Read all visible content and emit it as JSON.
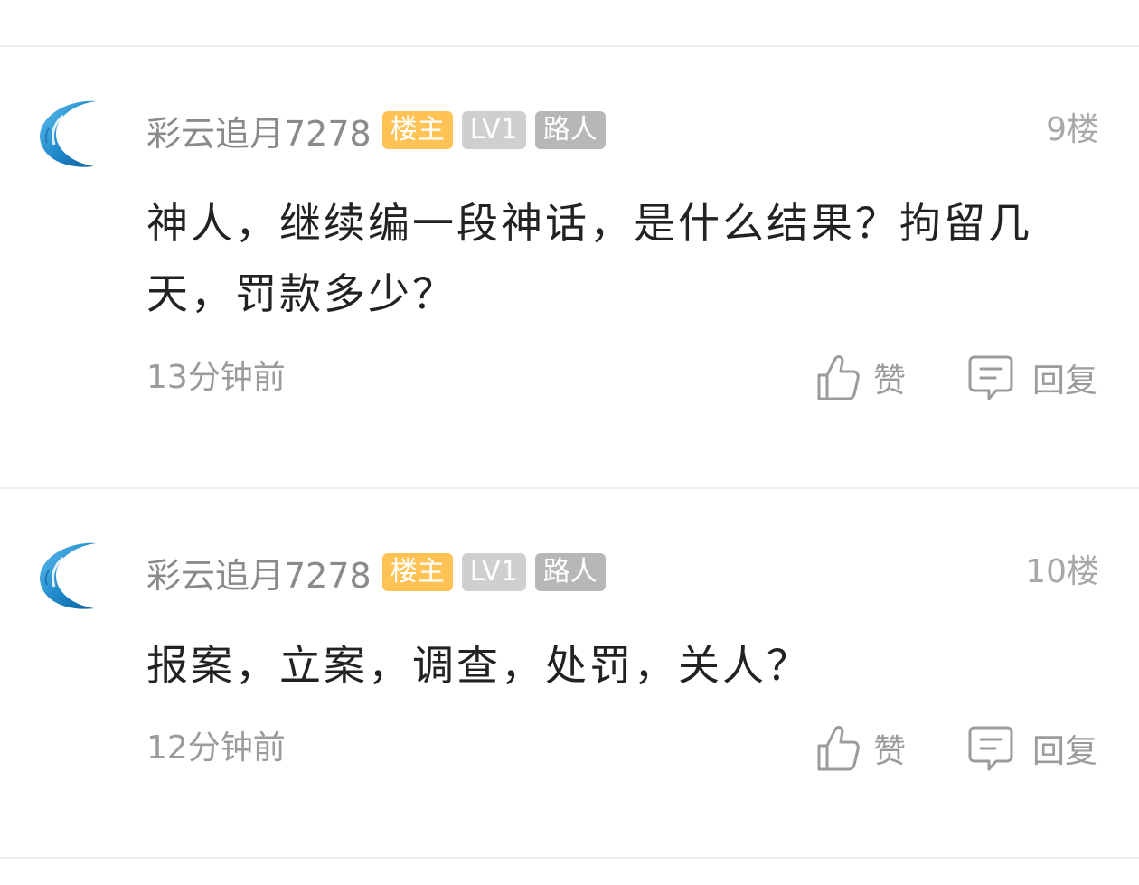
{
  "comments": [
    {
      "username": "彩云追月7278",
      "badge_op": "楼主",
      "badge_level": "LV1",
      "badge_role": "路人",
      "floor": "9楼",
      "content": "神人，继续编一段神话，是什么结果？拘留几天，罚款多少？",
      "time": "13分钟前",
      "like_label": "赞",
      "reply_label": "回复"
    },
    {
      "username": "彩云追月7278",
      "badge_op": "楼主",
      "badge_level": "LV1",
      "badge_role": "路人",
      "floor": "10楼",
      "content": "报案，立案，调查，处罚，关人？",
      "time": "12分钟前",
      "like_label": "赞",
      "reply_label": "回复"
    }
  ],
  "icons": {
    "avatar": "crescent-moon-icon",
    "like": "thumbs-up-icon",
    "reply": "speech-bubble-icon"
  },
  "colors": {
    "badge_op": "#ffc254",
    "badge_level": "#cfcfcf",
    "badge_role": "#b7b7b7",
    "avatar_blue": "#1f88c9"
  }
}
